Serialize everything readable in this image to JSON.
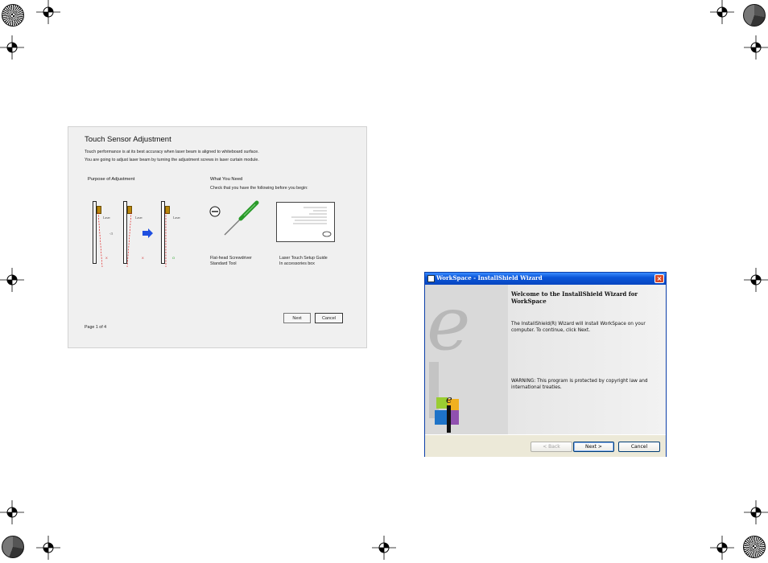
{
  "touch_panel": {
    "title": "Touch Sensor Adjustment",
    "intro_line1": "Touch performance is at its best accuracy when laser beam is aligned to whiteboard surface.",
    "intro_line2": "You are going to adjust laser beam by turning the adjustment screws in laser curtain module.",
    "purpose_heading": "Purpose of Adjustment",
    "need_heading": "What You Need",
    "need_subtext": "Check that you have the following before you begin:",
    "diagram_label": "Laser",
    "mark_x": "X",
    "mark_o": "O",
    "angle_label": "<5",
    "item1_line1": "Flat-head Screwdriver",
    "item1_line2": "Standard Tool",
    "item2_line1": "Laser Touch Setup Guide",
    "item2_line2": "In accessories box",
    "page_indicator": "Page 1 of 4",
    "next_label": "Next",
    "cancel_label": "Cancel"
  },
  "install_dialog": {
    "title": "WorkSpace - InstallShield Wizard",
    "heading": "Welcome to the InstallShield Wizard for WorkSpace",
    "body": "The InstallShield(R) Wizard will install WorkSpace on your computer. To continue, click Next.",
    "warning": "WARNING: This program is protected by copyright law and international treaties.",
    "back_label": "< Back",
    "next_label": "Next >",
    "cancel_label": "Cancel",
    "close_glyph": "×"
  }
}
